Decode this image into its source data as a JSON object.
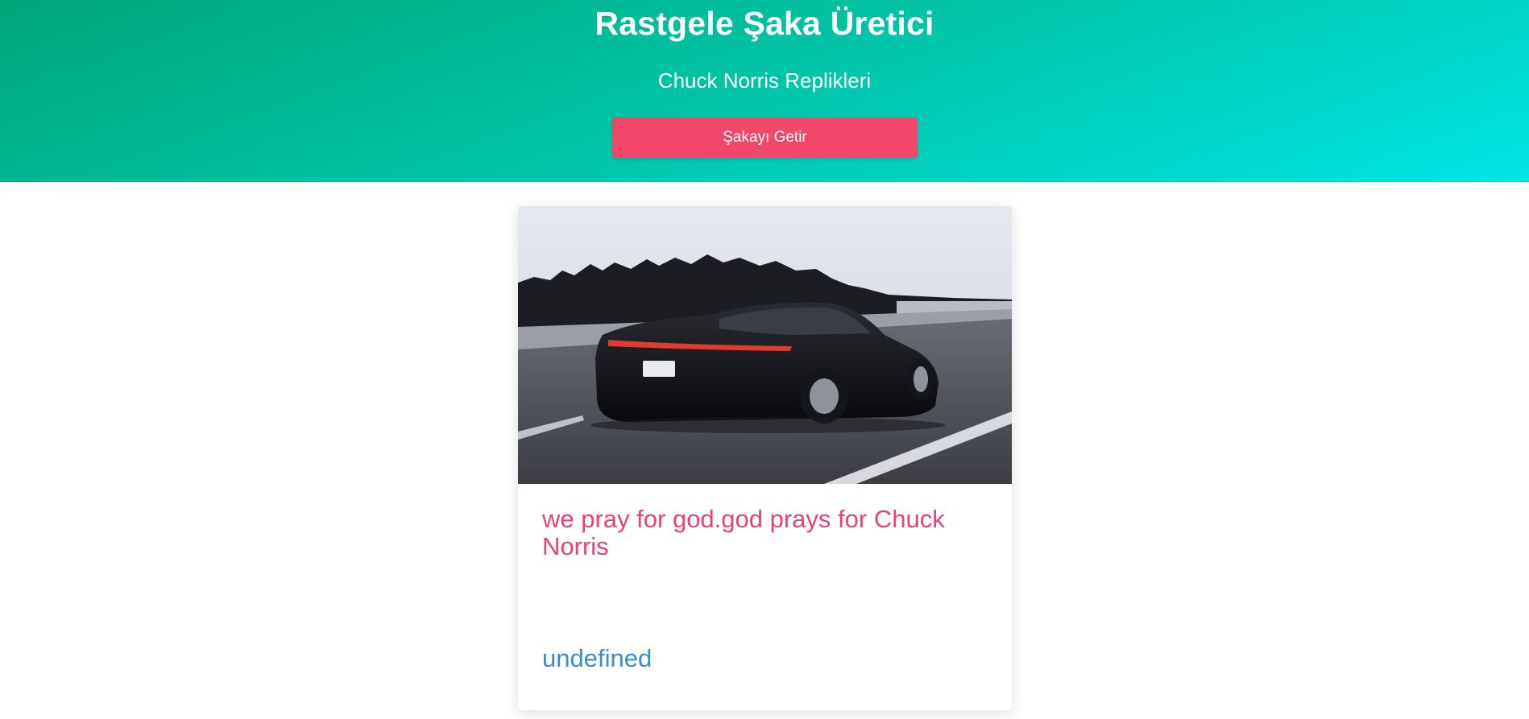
{
  "header": {
    "title": "Rastgele Şaka Üretici",
    "subtitle": "Chuck Norris Replikleri",
    "button_label": "Şakayı Getir"
  },
  "card": {
    "image_alt": "",
    "joke": "we pray for god.god prays for Chuck Norris",
    "category": "undefined"
  },
  "colors": {
    "gradient_start": "#00a67a",
    "gradient_end": "#00e5e5",
    "button": "#f2476a",
    "joke_text": "#e8436a",
    "category_text": "#3b8bd0"
  }
}
